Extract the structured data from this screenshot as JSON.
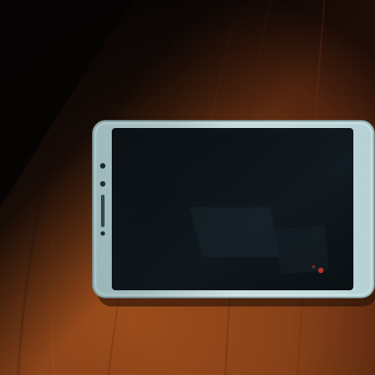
{
  "scene": {
    "subject": "smartphone-lying-face-up-on-wooden-table",
    "colors": {
      "table_light": "#a8501e",
      "table_mid": "#7a3a16",
      "table_dark": "#2a120a",
      "shadow": "#090505",
      "phone_body": "#cfe3e4",
      "phone_edge": "#93aeb2",
      "screen": "#0e1418",
      "screen_reflection": "#1a2a33",
      "accent_red": "#d23a2a"
    },
    "icons": {
      "phone": "smartphone-icon",
      "camera": "front-camera-icon",
      "sensor": "proximity-sensor-icon",
      "speaker": "earpiece-speaker-icon"
    }
  }
}
